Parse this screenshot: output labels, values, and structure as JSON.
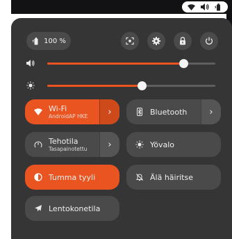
{
  "status": {
    "battery_percent": "100 %"
  },
  "sliders": {
    "volume": {
      "level": 0.81
    },
    "brightness": {
      "level": 0.56
    }
  },
  "tiles": {
    "wifi": {
      "label": "Wi-Fi",
      "sub": "AndroidAP HKE",
      "active": true
    },
    "bluetooth": {
      "label": "Bluetooth",
      "active": false
    },
    "power_mode": {
      "label": "Tehotila",
      "sub": "Tasapainotettu",
      "active": false
    },
    "night_light": {
      "label": "Yövalo",
      "active": false
    },
    "dark_style": {
      "label": "Tumma tyyli",
      "active": true
    },
    "dnd": {
      "label": "Älä häiritse",
      "active": false
    },
    "airplane": {
      "label": "Lentokonetila",
      "active": false
    }
  },
  "colors": {
    "accent": "#e95420",
    "panel": "#353535",
    "tile": "#4a4a4a"
  }
}
